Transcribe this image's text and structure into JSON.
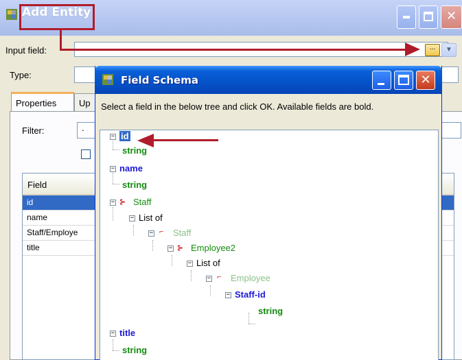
{
  "background_window": {
    "title": "Add Entity",
    "labels": {
      "input_field": "Input field:",
      "type": "Type:",
      "filter": "Filter:"
    },
    "filter_value": ".",
    "tabs": [
      {
        "label": "Properties"
      },
      {
        "label": "Up"
      }
    ],
    "grid": {
      "header": "Field",
      "rows": [
        {
          "value": "id",
          "selected": true
        },
        {
          "value": "name",
          "selected": false
        },
        {
          "value": "Staff/Employe",
          "selected": false
        },
        {
          "value": "title",
          "selected": false
        }
      ]
    },
    "browse_button_label": "..."
  },
  "dialog": {
    "title": "Field Schema",
    "message": "Select a field in the below tree and click OK. Available fields are bold.",
    "tree": [
      {
        "label": "id",
        "kind": "field",
        "selected": true
      },
      {
        "label": "string",
        "kind": "type"
      },
      {
        "label": "name",
        "kind": "field"
      },
      {
        "label": "string",
        "kind": "type"
      },
      {
        "label": "Staff",
        "kind": "complex"
      },
      {
        "label": "List of",
        "kind": "list"
      },
      {
        "label": "Staff",
        "kind": "element"
      },
      {
        "label": "Employee2",
        "kind": "complex"
      },
      {
        "label": "List of",
        "kind": "list"
      },
      {
        "label": "Employee",
        "kind": "element"
      },
      {
        "label": "Staff-id",
        "kind": "field"
      },
      {
        "label": "string",
        "kind": "type"
      },
      {
        "label": "title",
        "kind": "field"
      },
      {
        "label": "string",
        "kind": "type"
      }
    ]
  },
  "colors": {
    "annotation": "#b01c2a",
    "field": "#1b17d6",
    "type": "#148b0d",
    "selection": "#316ac5"
  },
  "icons": [
    "app-icon",
    "minimize-icon",
    "maximize-icon",
    "close-icon",
    "expand-collapse-icon",
    "complex-type-icon",
    "element-icon",
    "dropdown-icon"
  ]
}
